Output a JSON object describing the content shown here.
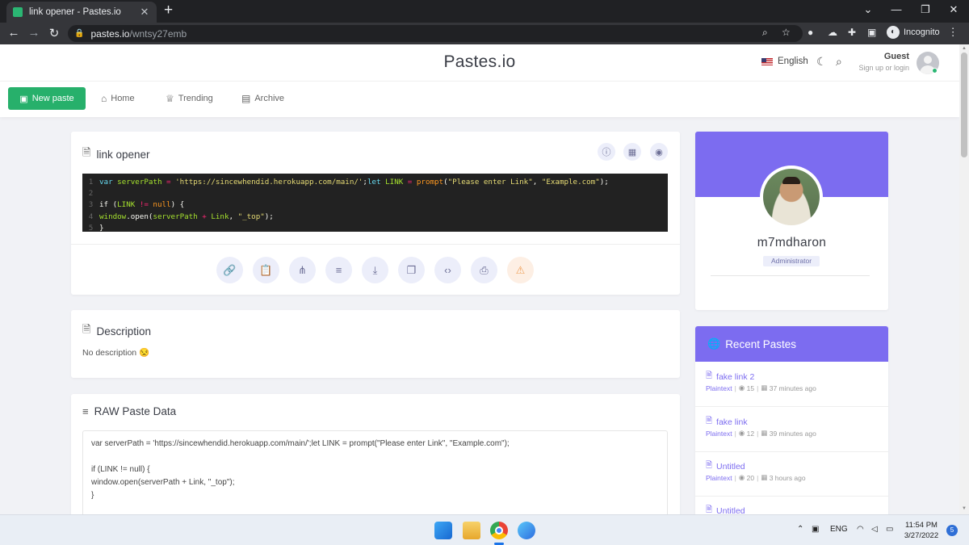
{
  "browser": {
    "tab_title": "link opener - Pastes.io",
    "url_host": "pastes.io",
    "url_path": "/wntsy27emb",
    "profile_label": "Incognito"
  },
  "site": {
    "logo": "Pastes.io",
    "language": "English",
    "guest_name": "Guest",
    "guest_sub": "Sign up or login"
  },
  "nav": {
    "new_paste": "New paste",
    "home": "Home",
    "trending": "Trending",
    "archive": "Archive"
  },
  "paste": {
    "title": "link opener",
    "code_lines": [
      "var serverPath = 'https://sincewhendid.herokuapp.com/main/';let LINK = prompt(\"Please enter Link\", \"Example.com\");",
      "",
      "if (LINK != null) {",
      "window.open(serverPath + Link, \"_top\");",
      "}"
    ],
    "line_numbers": [
      "1",
      "2",
      "3",
      "4",
      "5"
    ]
  },
  "description": {
    "title": "Description",
    "text": "No description 😒"
  },
  "raw": {
    "title": "RAW Paste Data",
    "text": "var serverPath = 'https://sincewhendid.herokuapp.com/main/';let LINK = prompt(\"Please enter Link\", \"Example.com\");\n\nif (LINK != null) {\nwindow.open(serverPath + Link, \"_top\");\n}"
  },
  "profile": {
    "username": "m7mdharon",
    "role": "Administrator"
  },
  "recent": {
    "title": "Recent Pastes",
    "items": [
      {
        "title": "fake link 2",
        "language": "Plaintext",
        "views": "15",
        "time": "37 minutes ago"
      },
      {
        "title": "fake link",
        "language": "Plaintext",
        "views": "12",
        "time": "39 minutes ago"
      },
      {
        "title": "Untitled",
        "language": "Plaintext",
        "views": "20",
        "time": "3 hours ago"
      },
      {
        "title": "Untitled",
        "language": "",
        "views": "",
        "time": ""
      }
    ]
  },
  "taskbar": {
    "lang": "ENG",
    "time": "11:54 PM",
    "date": "3/27/2022",
    "notifications": "5"
  },
  "colors": {
    "accent": "#7c6cf0",
    "new_paste_green": "#27b06b"
  }
}
